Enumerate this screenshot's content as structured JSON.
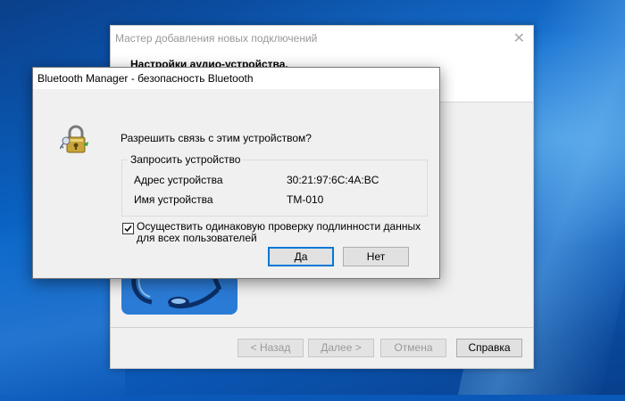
{
  "wizard": {
    "title": "Мастер добавления новых подключений",
    "header": "Настройки аудио-устройства.",
    "buttons": {
      "back": "< Назад",
      "next": "Далее >",
      "cancel": "Отмена",
      "help": "Справка"
    }
  },
  "dialog": {
    "title": "Bluetooth Manager - безопасность Bluetooth",
    "prompt": "Разрешить связь с этим устройством?",
    "group_title": "Запросить устройство",
    "rows": [
      {
        "label": "Адрес устройства",
        "value": "30:21:97:6C:4A:BC"
      },
      {
        "label": "Имя устройства",
        "value": "TM-010"
      }
    ],
    "checkbox": {
      "checked": true,
      "label": "Осуществить одинаковую проверку подлинности данных для всех пользователей"
    },
    "buttons": {
      "yes": "Да",
      "no": "Нет"
    }
  },
  "icons": {
    "dialog_icon": "padlock-key-icon",
    "wizard_close": "close-icon"
  },
  "colors": {
    "accent": "#0078d7",
    "desktop": "#0a58b8"
  }
}
